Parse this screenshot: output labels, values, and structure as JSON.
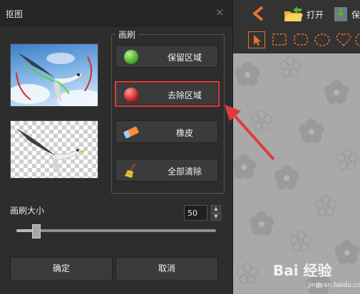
{
  "dialog": {
    "title": "抠图",
    "close_glyph": "×",
    "brush_group_label": "画刷",
    "tools": [
      {
        "label": "保留区域",
        "icon": "green-ball-icon",
        "color": "#49b52a"
      },
      {
        "label": "去除区域",
        "icon": "red-ball-icon",
        "color": "#d82020"
      },
      {
        "label": "橡皮",
        "icon": "eraser-icon",
        "color": "#ff8a3d"
      },
      {
        "label": "全部清除",
        "icon": "broom-icon",
        "color": "#e8c23a"
      }
    ],
    "selected_tool_index": 1,
    "brush_size_label": "画刷大小",
    "brush_size_value": "50",
    "slider_level": 0.1,
    "ok_label": "确定",
    "cancel_label": "取消"
  },
  "toolbar": {
    "back_icon": "back-chevron-icon",
    "open_label": "打开",
    "save_label_partial": "保",
    "shape_tools": [
      "pointer-icon",
      "rect-select-icon",
      "rounded-rect-select-icon",
      "ellipse-select-icon",
      "heart-select-icon"
    ]
  },
  "watermark": {
    "brand": "Bai 经验",
    "url": "jingyan.baidu.com"
  },
  "colors": {
    "highlight": "#e23b3b",
    "arrow": "#e23b3b",
    "accent_orange": "#e8732b"
  }
}
